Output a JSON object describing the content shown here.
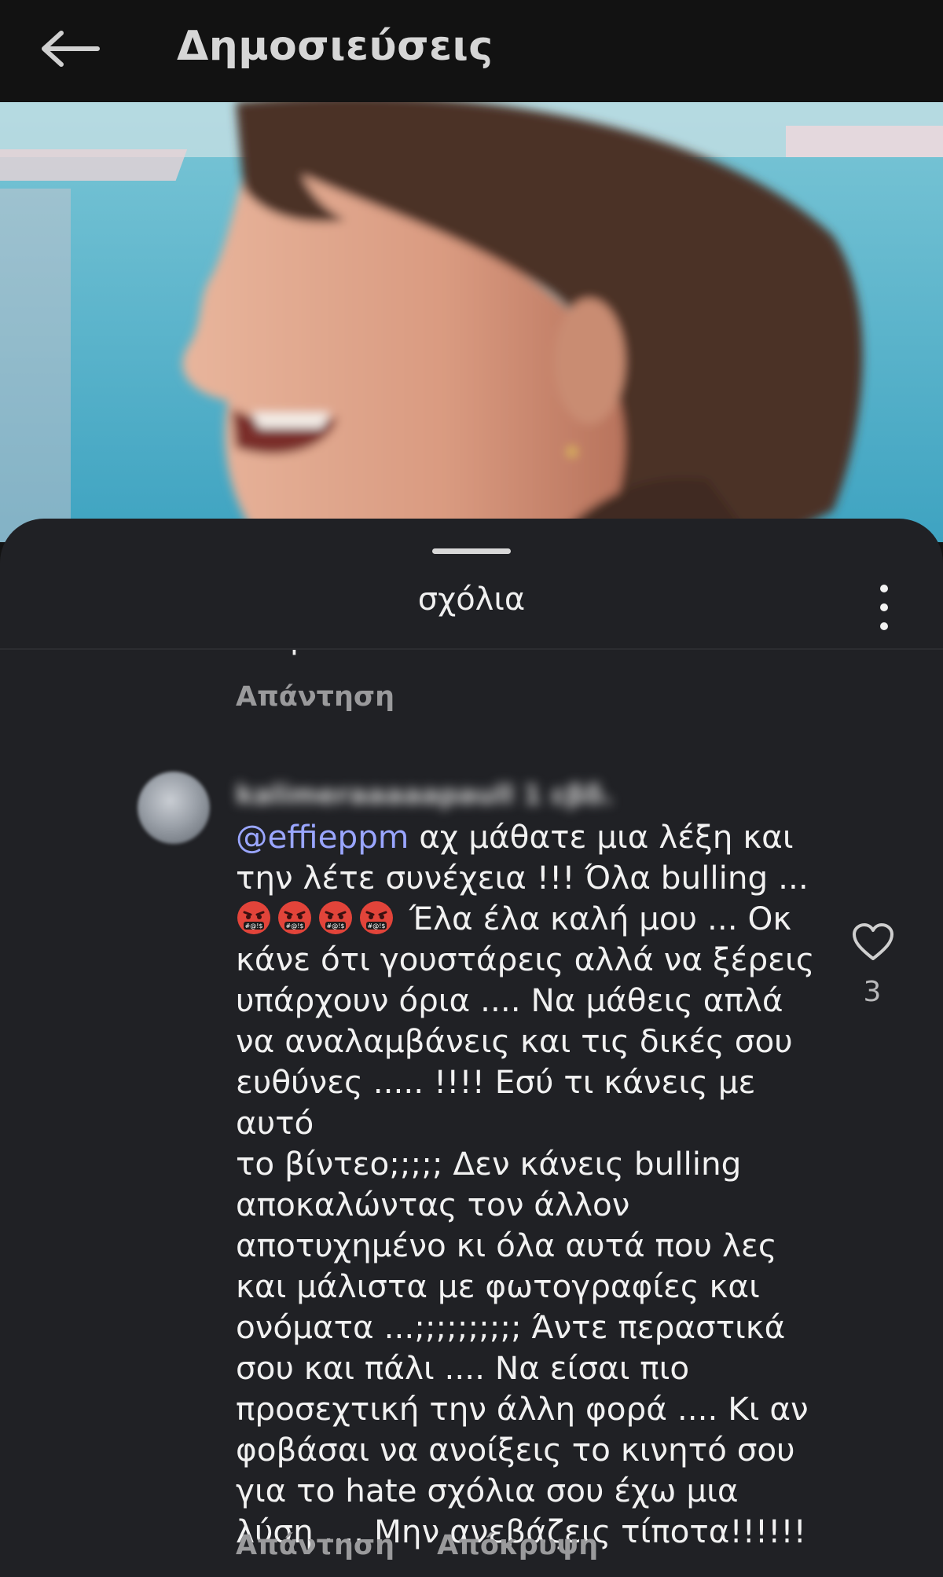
{
  "header": {
    "title": "Δημοσιεύσεις",
    "back_icon": "arrow-left-icon"
  },
  "sheet": {
    "title": "σχόλια",
    "more_icon": "more-vertical-icon"
  },
  "previous_comment": {
    "text_tail": "κλέβει",
    "reply_label": "Απάντηση"
  },
  "comment": {
    "username": "kalimeraaaaapaull",
    "time": "1 εβδ.",
    "mention": "@effieppm",
    "line_1_rest": " αχ μάθατε μια λέξη και",
    "line_2": "την λέτε συνέχεια !!! Όλα bulling ...",
    "emoji_run_after": " Έλα έλα καλή μου ... Οκ",
    "emoji_name": "angry-face-symbols-emoji",
    "emoji_count": 4,
    "body_rest": "κάνε ότι γουστάρεις αλλά να ξέρεις\nυπάρχουν όρια .... Να μάθεις απλά\nνα αναλαμβάνεις και τις δικές σου\nευθύνες ..... !!!! Εσύ τι κάνεις με αυτό\nτο βίντεο;;;;; Δεν κάνεις bulling\nαποκαλώντας τον άλλον\nαποτυχημένο κι όλα αυτά που λες\nκαι μάλιστα με φωτογραφίες και\nονόματα ...;;;;;;;;;; Άντε περαστικά\nσου και πάλι .... Να είσαι πιο\nπροσεχτική την άλλη φορά .... Κι αν\nφοβάσαι να ανοίξεις το κινητό σου\nγια το hate σχόλια σου έχω μια\nλύση .... Μην ανεβάζεις τίποτα!!!!!!",
    "like_count": "3",
    "like_icon": "heart-outline-icon",
    "reply_label": "Απάντηση",
    "hide_label": "Απόκρυψη"
  },
  "colors": {
    "background": "#202125",
    "appbar": "#121212",
    "text": "#f1f1f1",
    "muted": "#9a9a9c",
    "mention": "#9aa6ff"
  }
}
